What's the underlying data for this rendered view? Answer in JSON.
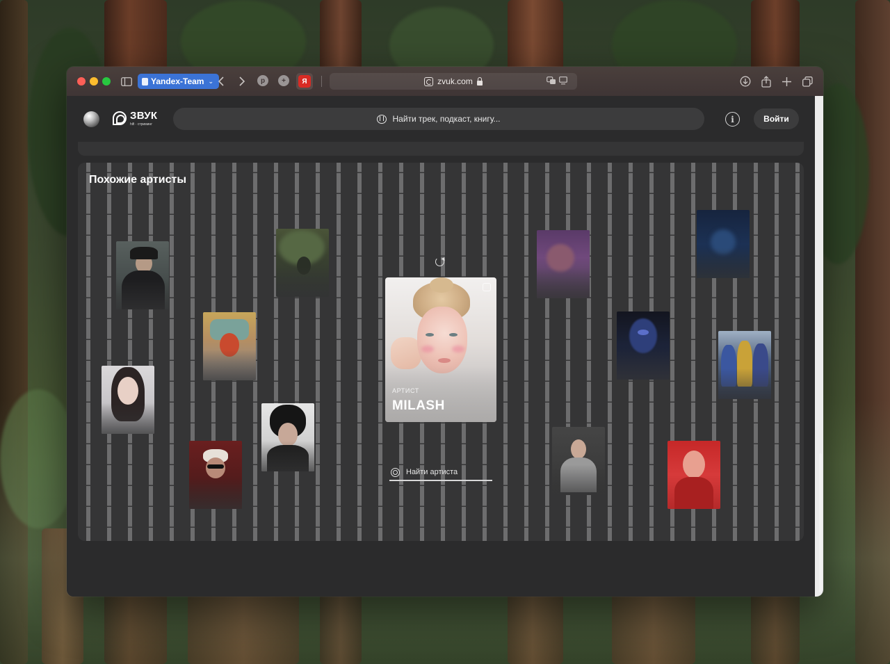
{
  "browser": {
    "profile_label": "Yandex-Team",
    "url": "zvuk.com",
    "extension_yandex_label": "Я"
  },
  "app": {
    "logo_word": "ЗВУК",
    "logo_sub": "hifi · стриминг",
    "search_placeholder": "Найти трек, подкаст, книгу...",
    "info_label": "i",
    "login_label": "Войти"
  },
  "similar": {
    "title": "Похожие артисты",
    "featured": {
      "kind": "АРТИСТ",
      "name": "MILASH"
    },
    "find_artist_placeholder": "Найти артиста"
  },
  "colors": {
    "accent_profile": "#3b73d6",
    "page_bg": "#2b2b2c",
    "card_bg": "#353536"
  }
}
